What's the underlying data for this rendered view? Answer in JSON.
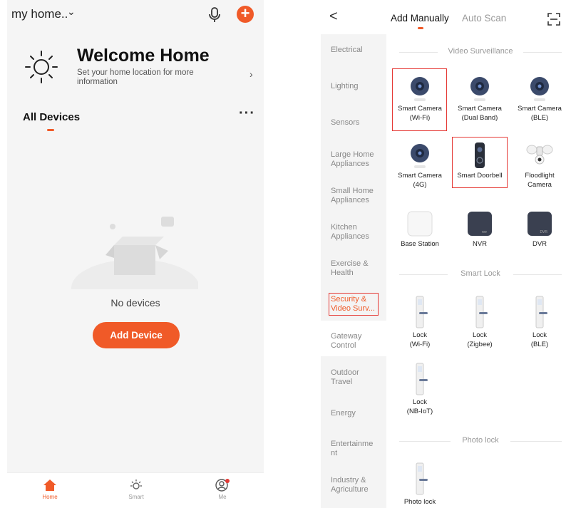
{
  "left_app": {
    "home_name": "my home..",
    "welcome_title": "Welcome Home",
    "welcome_subtitle": "Set your home location for more information",
    "all_devices_label": "All Devices",
    "empty_text": "No devices",
    "add_device_label": "Add Device",
    "tabs": [
      {
        "label": "Home",
        "icon": "home-icon"
      },
      {
        "label": "Smart",
        "icon": "sun-icon"
      },
      {
        "label": "Me",
        "icon": "profile-icon"
      }
    ]
  },
  "right_app": {
    "tabs": {
      "manual": "Add Manually",
      "auto": "Auto Scan"
    },
    "categories": [
      "Electrical",
      "Lighting",
      "Sensors",
      "Large Home Appliances",
      "Small Home Appliances",
      "Kitchen Appliances",
      "Exercise & Health",
      "Security & Video Surv...",
      "Gateway Control",
      "Outdoor Travel",
      "Energy",
      "Entertainme nt",
      "Industry & Agriculture"
    ],
    "active_category": "Security & Video Surv...",
    "sections": {
      "video": "Video Surveillance",
      "lock": "Smart Lock",
      "photo": "Photo lock"
    },
    "video_items": [
      {
        "line1": "Smart Camera",
        "line2": "(Wi-Fi)"
      },
      {
        "line1": "Smart Camera",
        "line2": "(Dual Band)"
      },
      {
        "line1": "Smart Camera",
        "line2": "(BLE)"
      },
      {
        "line1": "Smart Camera",
        "line2": "(4G)"
      },
      {
        "line1": "Smart Doorbell",
        "line2": ""
      },
      {
        "line1": "Floodlight",
        "line2": "Camera"
      },
      {
        "line1": "Base Station",
        "line2": ""
      },
      {
        "line1": "NVR",
        "line2": ""
      },
      {
        "line1": "DVR",
        "line2": ""
      }
    ],
    "device_marks": {
      "nvr": "nvr",
      "dvr": "DVR"
    },
    "lock_items": [
      {
        "line1": "Lock",
        "line2": "(Wi-Fi)"
      },
      {
        "line1": "Lock",
        "line2": "(Zigbee)"
      },
      {
        "line1": "Lock",
        "line2": "(BLE)"
      },
      {
        "line1": "Lock",
        "line2": "(NB-IoT)"
      }
    ],
    "photo_items": [
      {
        "line1": "Photo lock",
        "line2": ""
      }
    ]
  },
  "colors": {
    "accent": "#f05a28",
    "highlight": "#e53935"
  }
}
